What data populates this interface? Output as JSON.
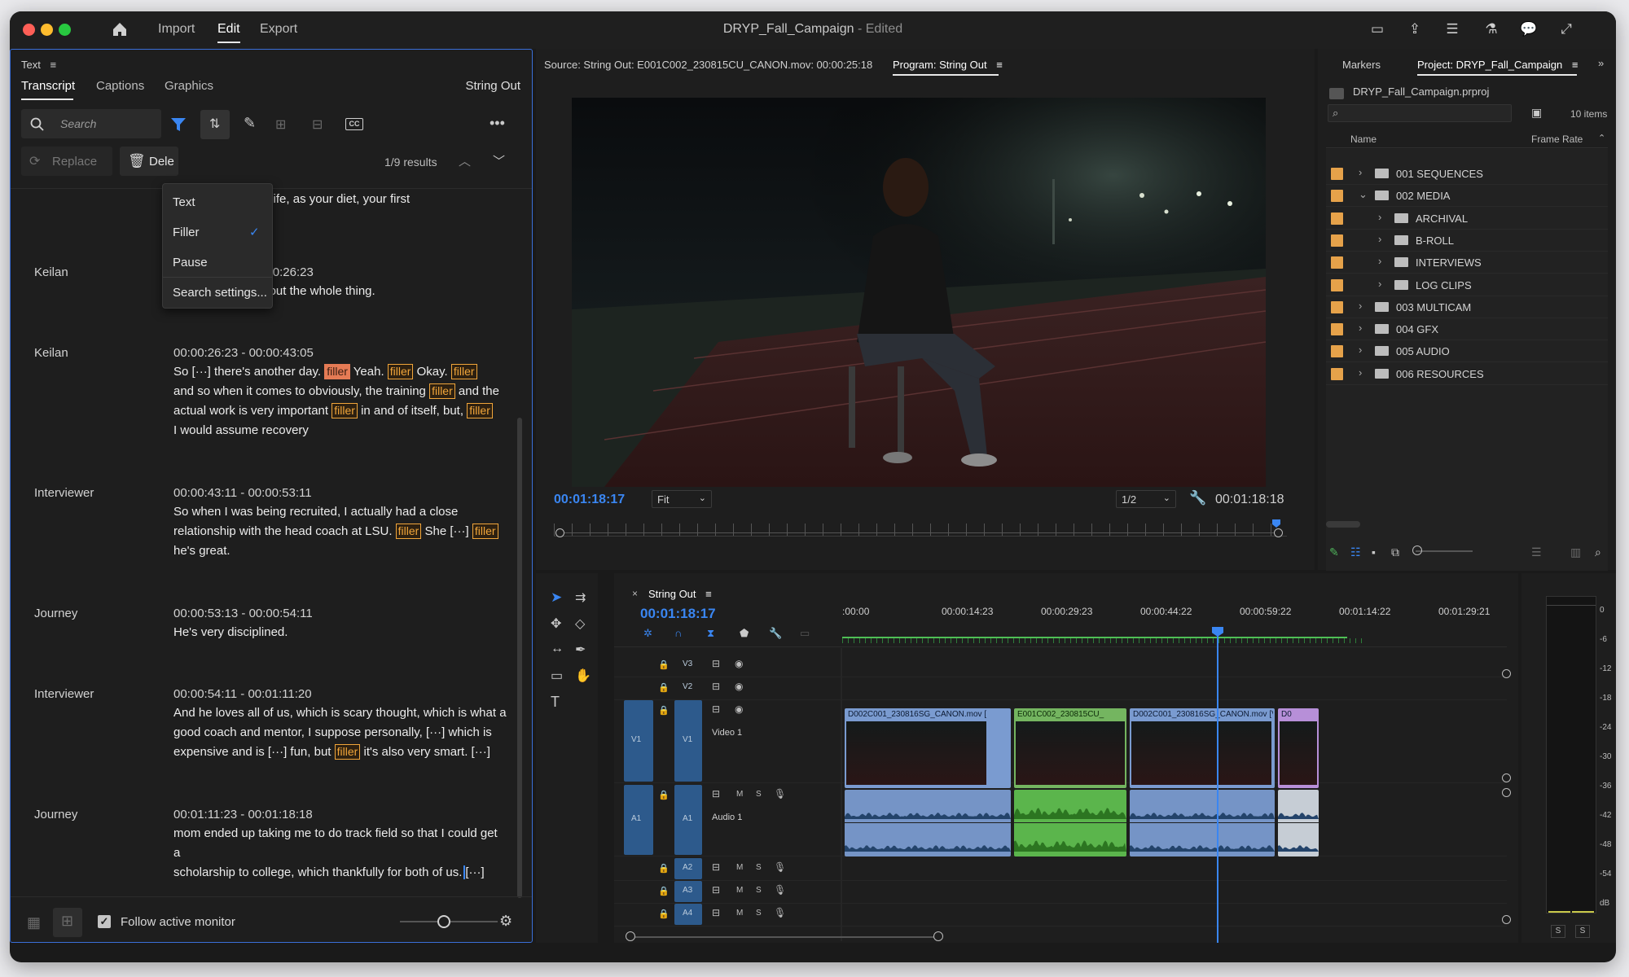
{
  "app": {
    "nav": [
      "Import",
      "Edit",
      "Export"
    ],
    "active_nav": "Edit",
    "window_title": "DRYP_Fall_Campaign",
    "window_status": "- Edited"
  },
  "text_panel": {
    "title": "Text",
    "tabs": [
      "Transcript",
      "Captions",
      "Graphics"
    ],
    "active_tab": "Transcript",
    "sequence": "String Out",
    "search_placeholder": "Search",
    "replace_label": "Replace",
    "delete_label": "Dele",
    "results": "1/9 results",
    "dropdown": {
      "items": [
        "Text",
        "Filler",
        "Pause",
        "Search settings..."
      ],
      "checked": "Filler"
    },
    "first_line": "of rely on as your life, as your diet, your first",
    "entries": [
      {
        "speaker": "Keilan",
        "timecode": "00:00:25:18 - 00:00:26:23",
        "lines": [
          "be strong throughout the whole thing."
        ]
      },
      {
        "speaker": "Keilan",
        "timecode": "00:00:26:23 - 00:00:43:05"
      },
      {
        "speaker": "Interviewer",
        "timecode": "00:00:43:11 - 00:00:53:11"
      },
      {
        "speaker": "Journey",
        "timecode": "00:00:53:13 - 00:00:54:11",
        "lines": [
          "He's very disciplined."
        ]
      },
      {
        "speaker": "Interviewer",
        "timecode": "00:00:54:11 - 00:01:11:20"
      },
      {
        "speaker": "Journey",
        "timecode": "00:01:11:23 - 00:01:18:18"
      }
    ],
    "filler_tag": "filler",
    "ellipsis": "[···]",
    "seg2": {
      "l1a": "So",
      "l1b": "there's another day.",
      "l1c": "Yeah.",
      "l1d": "Okay.",
      "l2a": "and so when it comes to obviously, the training",
      "l2b": "and the",
      "l3a": "actual work is very important",
      "l3b": "in and of itself, but,",
      "l4": "I would assume recovery"
    },
    "seg3": {
      "l1": "So when I was being recruited, I actually had a close",
      "l2a": "relationship with the head coach at LSU.",
      "l2b": "She",
      "l3": "he's great."
    },
    "seg5": {
      "l1": "And he loves all of us, which is scary thought, which is what a",
      "l2a": "good coach and mentor, I suppose personally,",
      "l2b": "which is",
      "l3a": "expensive and is",
      "l3b": "fun, but",
      "l3c": "it's also very smart."
    },
    "seg6": {
      "l1": "mom ended up taking me to do track field so that I could get a",
      "l2": "scholarship to college, which thankfully for both of us."
    },
    "follow_label": "Follow active monitor",
    "follow_checked": true
  },
  "monitor": {
    "source_label": "Source: String Out: E001C002_230815CU_CANON.mov: 00:00:25:18",
    "program_label": "Program: String Out",
    "timecode_left": "00:01:18:17",
    "timecode_right": "00:01:18:18",
    "fit": "Fit",
    "resolution": "1/2"
  },
  "project": {
    "tabs": [
      "Markers",
      "Project: DRYP_Fall_Campaign"
    ],
    "file": "DRYP_Fall_Campaign.prproj",
    "items_count": "10 items",
    "col_name": "Name",
    "col_frame_rate": "Frame Rate",
    "rows": [
      {
        "name": "001 SEQUENCES",
        "level": 0,
        "expanded": false
      },
      {
        "name": "002 MEDIA",
        "level": 0,
        "expanded": true
      },
      {
        "name": "ARCHIVAL",
        "level": 1,
        "expanded": false
      },
      {
        "name": "B-ROLL",
        "level": 1,
        "expanded": false
      },
      {
        "name": "INTERVIEWS",
        "level": 1,
        "expanded": false
      },
      {
        "name": "LOG CLIPS",
        "level": 1,
        "expanded": false
      },
      {
        "name": "003 MULTICAM",
        "level": 0,
        "expanded": false
      },
      {
        "name": "004 GFX",
        "level": 0,
        "expanded": false
      },
      {
        "name": "005 AUDIO",
        "level": 0,
        "expanded": false
      },
      {
        "name": "006 RESOURCES",
        "level": 0,
        "expanded": false
      }
    ]
  },
  "timeline": {
    "sequence": "String Out",
    "timecode": "00:01:18:17",
    "ruler": [
      ":00:00",
      "00:00:14:23",
      "00:00:29:23",
      "00:00:44:22",
      "00:00:59:22",
      "00:01:14:22",
      "00:01:29:21"
    ],
    "tracks": {
      "v3": "V3",
      "v2": "V2",
      "v1": "V1",
      "a1": "A1",
      "a2": "A2",
      "a3": "A3",
      "a4": "A4",
      "video1": "Video 1",
      "audio1": "Audio 1",
      "m": "M",
      "s": "S"
    },
    "clips": [
      {
        "title": "D002C001_230816SG_CANON.mov [",
        "color": "#7a9bd0"
      },
      {
        "title": "E001C002_230815CU_",
        "color": "#74b560"
      },
      {
        "title": "D002C001_230816SG_CANON.mov [V]",
        "color": "#7a9bd0"
      },
      {
        "title": "D0",
        "color": "#b78fd8"
      }
    ]
  },
  "meter": {
    "labels": [
      "0",
      "-6",
      "-12",
      "-18",
      "-24",
      "-30",
      "-36",
      "-42",
      "-48",
      "-54",
      "dB"
    ],
    "solo": [
      "S",
      "S"
    ]
  }
}
